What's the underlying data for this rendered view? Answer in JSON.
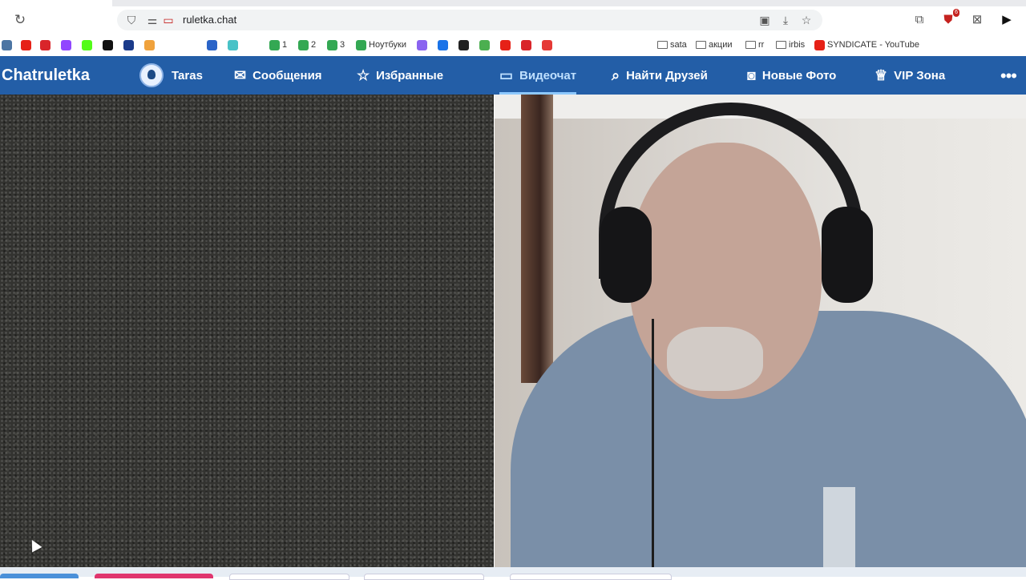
{
  "browser": {
    "url": "ruletka.chat",
    "extension_badge": "6",
    "bookmarks": [
      {
        "label": "",
        "color": "#4c75a3"
      },
      {
        "label": "",
        "color": "#e62117"
      },
      {
        "label": "",
        "color": "#d9252a"
      },
      {
        "label": "",
        "color": "#9146ff"
      },
      {
        "label": "",
        "color": "#53fc18"
      },
      {
        "label": "",
        "color": "#111111"
      },
      {
        "label": "",
        "color": "#1a3a8a"
      },
      {
        "label": "",
        "color": "#f0a23c"
      },
      {
        "label": "",
        "color": "#2a64c8"
      },
      {
        "label": "",
        "color": "#48c2c7"
      },
      {
        "label": "1",
        "color": "#34a853"
      },
      {
        "label": "2",
        "color": "#34a853"
      },
      {
        "label": "3",
        "color": "#34a853"
      },
      {
        "label": "Ноутбуки",
        "color": "#34a853"
      },
      {
        "label": "",
        "color": "#8a63f0"
      },
      {
        "label": "",
        "color": "#1a73e8"
      },
      {
        "label": "",
        "color": "#222222"
      },
      {
        "label": "",
        "color": "#4caf50"
      },
      {
        "label": "",
        "color": "#e62117"
      },
      {
        "label": "",
        "color": "#d9252a"
      },
      {
        "label": "",
        "color": "#e53935"
      }
    ],
    "folders": [
      "sata",
      "акции",
      "rr",
      "irbis"
    ],
    "youtube_bookmark": "SYNDICATE - YouTube"
  },
  "site": {
    "brand": "Chatruletka",
    "user_name": "Taras",
    "nav": {
      "messages": "Сообщения",
      "favorites": "Избранные",
      "videochat": "Видеочат",
      "find_friends": "Найти Друзей",
      "new_photos": "Новые Фото",
      "vip": "VIP Зона"
    },
    "more": "•••"
  },
  "icons": {
    "reload": "reload-icon",
    "shield": "shield-icon",
    "messages": "mail-icon",
    "favorites": "star-icon",
    "videochat": "video-camera-icon",
    "search": "search-icon",
    "photos": "camera-icon",
    "vip": "crown-icon"
  },
  "colors": {
    "nav_bg": "#235ea7",
    "nav_active": "#bfe0ff"
  }
}
